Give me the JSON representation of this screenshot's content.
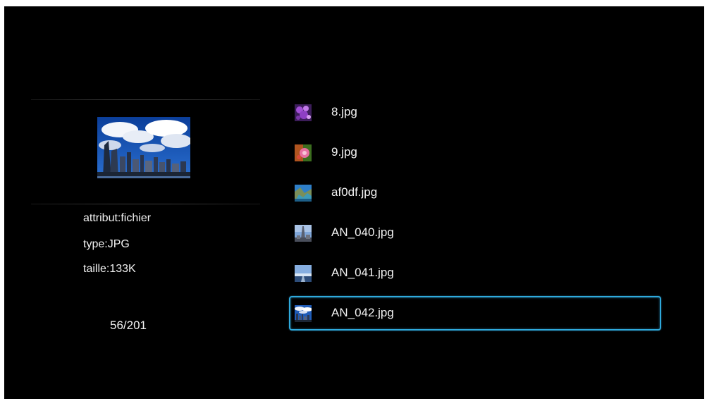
{
  "info": {
    "attribute": "attribut:fichier",
    "type": "type:JPG",
    "size": "taille:133K"
  },
  "counter": "56/201",
  "files": [
    {
      "name": "8.jpg",
      "thumbnail": "purple-flowers-thumbnail"
    },
    {
      "name": "9.jpg",
      "thumbnail": "pink-flower-thumbnail"
    },
    {
      "name": "af0df.jpg",
      "thumbnail": "landscape-thumbnail"
    },
    {
      "name": "AN_040.jpg",
      "thumbnail": "tower-sky-thumbnail"
    },
    {
      "name": "AN_041.jpg",
      "thumbnail": "road-sky-thumbnail"
    },
    {
      "name": "AN_042.jpg",
      "thumbnail": "city-skyline-thumbnail",
      "selected": true
    }
  ],
  "colors": {
    "background": "#000000",
    "text": "#f2f2f2",
    "selection_border": "#2fa9dc"
  }
}
